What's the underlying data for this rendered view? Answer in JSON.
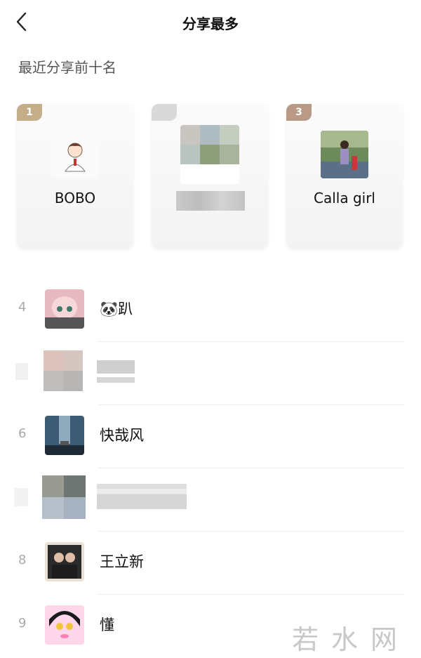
{
  "header": {
    "title": "分享最多"
  },
  "section": {
    "title": "最近分享前十名"
  },
  "top_cards": [
    {
      "rank": "1",
      "name": "BOBO",
      "badge_color": "#c4ae8a"
    },
    {
      "rank": "",
      "name": "",
      "badge_color": "#d9d9d9"
    },
    {
      "rank": "3",
      "name": "Calla girl",
      "badge_color": "#b89a86"
    }
  ],
  "list": [
    {
      "rank": "4",
      "name": "🐼趴"
    },
    {
      "rank": "",
      "name": ""
    },
    {
      "rank": "6",
      "name": "快哉风"
    },
    {
      "rank": "",
      "name": ""
    },
    {
      "rank": "8",
      "name": "王立新"
    },
    {
      "rank": "9",
      "name": "懂"
    }
  ],
  "watermark": {
    "text": "若水网"
  }
}
